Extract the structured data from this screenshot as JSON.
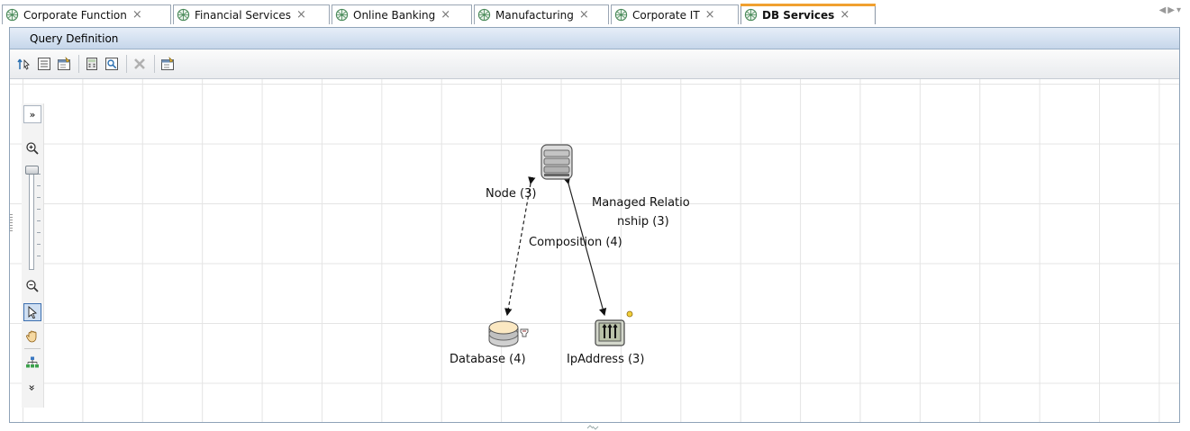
{
  "tabs": [
    {
      "label": "Corporate Function",
      "active": false
    },
    {
      "label": "Financial Services",
      "active": false
    },
    {
      "label": "Online Banking",
      "active": false
    },
    {
      "label": "Manufacturing",
      "active": false
    },
    {
      "label": "Corporate IT",
      "active": false
    },
    {
      "label": "DB Services",
      "active": true
    }
  ],
  "tab_close_glyph": "×",
  "tab_nav_glyph": "◀▶▾",
  "panel": {
    "title": "Query Definition"
  },
  "toolbar": {
    "buttons": [
      "select-pointer-icon",
      "list-view-icon",
      "properties-icon",
      "calculator-icon",
      "preview-icon",
      "delete-icon",
      "properties-icon"
    ]
  },
  "zoom": {
    "expand_glyph": "»",
    "more_glyph": "»",
    "tools": [
      "zoom-in-icon",
      "zoom-slider",
      "zoom-out-icon",
      "pointer-tool-icon",
      "pan-hand-icon",
      "layout-icon"
    ]
  },
  "graph": {
    "nodes": {
      "node": {
        "label": "Node (3)",
        "icon": "server-stack-icon"
      },
      "database": {
        "label": "Database (4)",
        "icon": "database-icon"
      },
      "ipaddress": {
        "label": "IpAddress (3)",
        "icon": "ip-address-icon"
      }
    },
    "edges": {
      "composition": {
        "label": "Composition (4)",
        "style": "dashed"
      },
      "managed": {
        "label_line1": "Managed Relatio",
        "label_line2": "nship (3)",
        "style": "solid"
      }
    }
  },
  "colors": {
    "accent_tab": "#f0a030",
    "panel_header": "#c6d6ea",
    "grid": "#e4e4e4"
  }
}
